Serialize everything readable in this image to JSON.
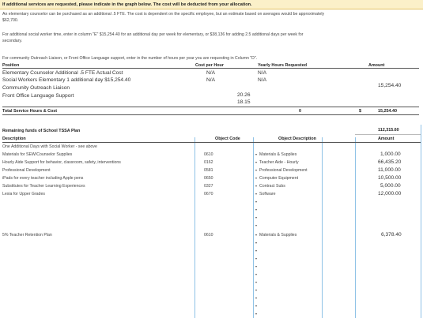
{
  "notice": "If additional services are requested, please indicate in the graph below.  The cost will be deducted from your allocation.",
  "para1_a": "An elementary counselor can be purchased as an additional .5 FTE.  The cost is dependent on the specific employee, but an estimate based on averages would be approximately",
  "para1_b": "$62,700.",
  "para2_a": "For additional social worker time, enter in column \"E\" $15,254.40 for an additional day per week for elementary, or $38,136 for adding 2.5 additional days per week for",
  "para2_b": "secondary.",
  "para3": "For community Outreach Liaison, or Front Office Language support, enter in the number of hours per year you are requesting in Column \"D\".",
  "services": {
    "headers": {
      "position": "Position",
      "cost": "Cost per Hour",
      "hours": "Yearly Hours Requested",
      "amount": "Amount"
    },
    "rows": [
      {
        "position": "Elementary Counselor Additional .5 FTE   Actual Cost",
        "cost": "N/A",
        "hours": "N/A",
        "amount": ""
      },
      {
        "position": "Social Workers Elementary 1 additional day $15,254.40",
        "cost": "N/A",
        "hours": "N/A",
        "amount": "15,254.40"
      },
      {
        "position": "Community Outreach Liaison",
        "cost": "20.26",
        "hours": "",
        "amount": ""
      },
      {
        "position": "Front Office Language Support",
        "cost": "18.15",
        "hours": "",
        "amount": ""
      }
    ],
    "total": {
      "label": "Total Service Hours & Cost",
      "hours": "0",
      "currency": "$",
      "amount": "15,254.40"
    }
  },
  "plan": {
    "remaining_label": "Remaining funds of School TSSA Plan",
    "remaining_value": "112,315.60",
    "headers": {
      "description": "Description",
      "code": "Object Code",
      "object_desc": "Object Description",
      "amount": "Amount"
    },
    "note_row": "One Additional Days with Social Worker - see above",
    "rows": [
      {
        "description": "Materials for SEW/Counselor Supplies",
        "code": "0610",
        "object_desc": "Materials & Supplies",
        "amount": "1,000.00"
      },
      {
        "description": "Hourly Aide Support for behavior, classroom, safety, interventions",
        "code": "0162",
        "object_desc": "Teacher Aide - Hourly",
        "amount": "66,435.20"
      },
      {
        "description": "Professional Development",
        "code": "0581",
        "object_desc": "Professional Development",
        "amount": "11,000.00"
      },
      {
        "description": "iPads for every teacher including Apple pens",
        "code": "0650",
        "object_desc": "Computer Equipment",
        "amount": "10,500.00"
      },
      {
        "description": "Substitutes for Teacher Learning Experiences",
        "code": "0327",
        "object_desc": "Contract Subs",
        "amount": "5,000.00"
      },
      {
        "description": "Lexia for Upper Grades",
        "code": "0670",
        "object_desc": "Software",
        "amount": "12,000.00"
      }
    ],
    "retention": {
      "description": "5% Teacher Retention Plan",
      "code": "0610",
      "object_desc": "Materials & Supplies",
      "amount": "6,378.40"
    }
  },
  "colors": {
    "notice_bg": "#fbf0c9",
    "grid_line": "#8ec2e6",
    "header_line": "#555555"
  }
}
